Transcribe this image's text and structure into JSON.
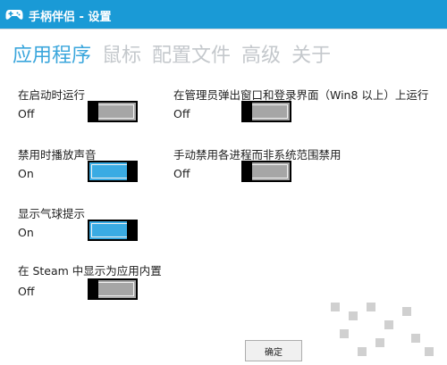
{
  "window": {
    "title": "手柄伴侣 - 设置"
  },
  "tabs": [
    {
      "label": "应用程序",
      "active": true
    },
    {
      "label": "鼠标",
      "active": false
    },
    {
      "label": "配置文件",
      "active": false
    },
    {
      "label": "高级",
      "active": false
    },
    {
      "label": "关于",
      "active": false
    }
  ],
  "settings": {
    "run_at_startup": {
      "label": "在启动时运行",
      "state": "Off",
      "on": false
    },
    "run_on_admin_popup": {
      "label": "在管理员弹出窗口和登录界面（Win8 以上）上运行",
      "state": "Off",
      "on": false
    },
    "play_sound_on_disable": {
      "label": "禁用时播放声音",
      "state": "On",
      "on": true
    },
    "manual_disable_per_process": {
      "label": "手动禁用各进程而非系统范围禁用",
      "state": "Off",
      "on": false
    },
    "show_balloon_tips": {
      "label": "显示气球提示",
      "state": "On",
      "on": true
    },
    "show_as_steam_builtin": {
      "label": "在 Steam 中显示为应用内置",
      "state": "Off",
      "on": false
    }
  },
  "footer": {
    "ok_label": "确定"
  },
  "colors": {
    "titlebar": "#1a9ad6",
    "active_tab": "#3aa6dc",
    "inactive_tab": "#c4c8cc",
    "toggle_on": "#3aabe3",
    "toggle_off": "#a6a6a6"
  }
}
